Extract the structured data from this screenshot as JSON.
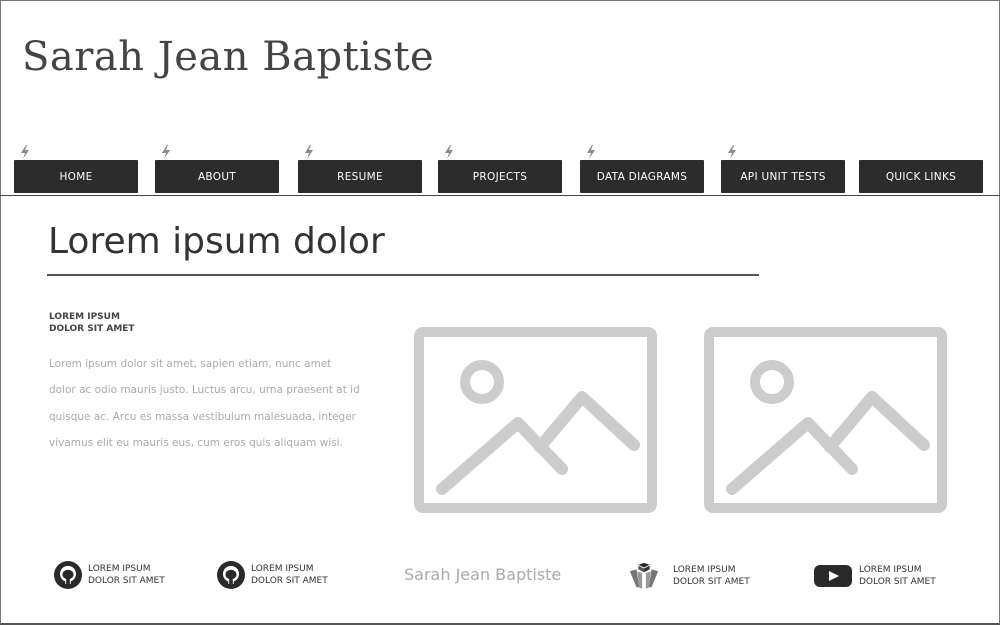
{
  "header": {
    "site_title": "Sarah Jean Baptiste"
  },
  "nav": {
    "items": [
      {
        "label": "HOME",
        "has_bolt": true
      },
      {
        "label": "ABOUT",
        "has_bolt": true
      },
      {
        "label": "RESUME",
        "has_bolt": true
      },
      {
        "label": "PROJECTS",
        "has_bolt": true
      },
      {
        "label": "DATA DIAGRAMS",
        "has_bolt": true
      },
      {
        "label": "API UNIT TESTS",
        "has_bolt": true
      },
      {
        "label": "QUICK LINKS",
        "has_bolt": false
      }
    ]
  },
  "main": {
    "heading": "Lorem ipsum dolor",
    "subhead_line1": "LOREM IPSUM",
    "subhead_line2": "DOLOR SIT AMET",
    "body": "Lorem ipsum dolor sit amet, sapien etiam, nunc amet dolor ac odio mauris justo. Luctus arcu, urna praesent at id quisque ac. Arcu es massa vestibulum malesuada, integer vivamus elit eu mauris eus, cum eros quis aliquam wisi.",
    "images": [
      "image-placeholder-icon",
      "image-placeholder-icon"
    ]
  },
  "footer": {
    "brand": "Sarah Jean Baptiste",
    "links": [
      {
        "icon": "github-icon",
        "line1": "LOREM IPSUM",
        "line2": "DOLOR SIT AMET"
      },
      {
        "icon": "github-icon",
        "line1": "LOREM IPSUM",
        "line2": "DOLOR SIT AMET"
      },
      {
        "icon": "tool-icon",
        "line1": "LOREM IPSUM",
        "line2": "DOLOR SIT AMET"
      },
      {
        "icon": "youtube-icon",
        "line1": "LOREM IPSUM",
        "line2": "DOLOR SIT AMET"
      }
    ]
  },
  "colors": {
    "nav_background": "#2c2c2c",
    "nav_text": "#ffffff",
    "placeholder_gray": "#cccccc",
    "body_text": "#aaaaaa"
  }
}
